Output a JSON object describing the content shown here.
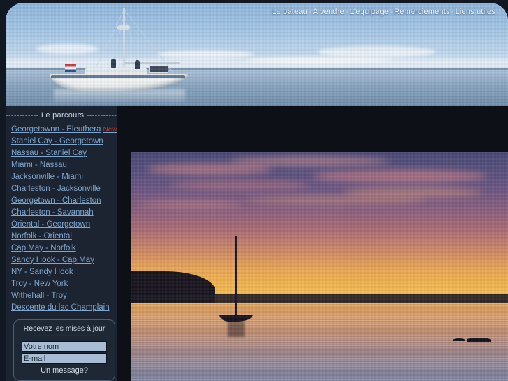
{
  "topnav": {
    "items": [
      {
        "label": "Le bateau"
      },
      {
        "label": "A vendre"
      },
      {
        "label": "L'equipage"
      },
      {
        "label": "Remerciements"
      },
      {
        "label": "Liens utiles"
      }
    ],
    "separator": "-"
  },
  "sidebar": {
    "section_title": "------------ Le parcours ------------",
    "items": [
      {
        "label": "Georgetownn - Eleuthera",
        "badge": "New"
      },
      {
        "label": "Staniel Cay - Georgetown",
        "badge": ""
      },
      {
        "label": "Nassau - Staniel Cay",
        "badge": ""
      },
      {
        "label": "Miami - Nassau",
        "badge": ""
      },
      {
        "label": "Jacksonville - Miami",
        "badge": ""
      },
      {
        "label": "Charleston - Jacksonville",
        "badge": ""
      },
      {
        "label": "Georgetown - Charleston",
        "badge": ""
      },
      {
        "label": "Charleston - Savannah",
        "badge": ""
      },
      {
        "label": "Oriental - Georgetown",
        "badge": ""
      },
      {
        "label": "Norfolk - Oriental",
        "badge": ""
      },
      {
        "label": "Cap May - Norfolk",
        "badge": ""
      },
      {
        "label": "Sandy Hook - Cap May",
        "badge": ""
      },
      {
        "label": "NY - Sandy Hook",
        "badge": ""
      },
      {
        "label": "Troy - New York",
        "badge": ""
      },
      {
        "label": "Withehall - Troy",
        "badge": ""
      },
      {
        "label": "Descente du lac Champlain",
        "badge": ""
      }
    ]
  },
  "newsletter": {
    "title": "Recevez les mises à jour",
    "divider": "-----------------------------------",
    "name_value": "Votre nom",
    "name_placeholder": "Votre nom",
    "email_value": "E-mail",
    "email_placeholder": "E-mail",
    "message_label": "Un message?"
  },
  "images": {
    "header_photo_alt": "sailboat-at-anchor-daylight",
    "main_photo_alt": "sailboat-at-anchor-sunset"
  },
  "colors": {
    "link": "#7fa6cf",
    "badge_new": "#c0392b",
    "sidebar_bg": "#1b2430",
    "page_bg": "#121821",
    "nav_text": "#eef4fb"
  }
}
